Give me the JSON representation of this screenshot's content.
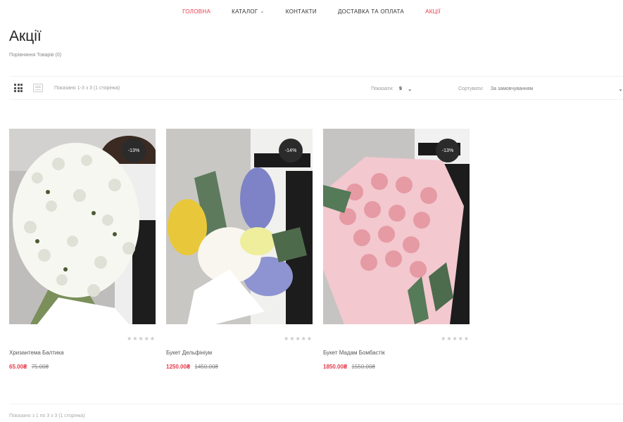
{
  "nav": {
    "items": [
      {
        "label": "ГОЛОВНА",
        "accent": true
      },
      {
        "label": "КАТАЛОГ",
        "accent": false,
        "dropdown": true
      },
      {
        "label": "КОНТАКТИ",
        "accent": false
      },
      {
        "label": "ДОСТАВКА ТА ОПЛАТА",
        "accent": false
      },
      {
        "label": "АКЦІЇ",
        "accent": true
      }
    ]
  },
  "page": {
    "title": "Акції",
    "compare": "Порівняння Товарів (0)"
  },
  "toolbar": {
    "showing": "Показано 1-3 з 3 (1 сторінка)",
    "per_page_label": "Показати:",
    "per_page_value": "9",
    "sort_label": "Сортувати:",
    "sort_value": "За замовчуванням"
  },
  "products": [
    {
      "name": "Хризантема Балтика",
      "price": "65.00₴",
      "old_price": "75.00₴",
      "discount": "-13%",
      "stars": "★★★★★"
    },
    {
      "name": "Букет Дельфініум",
      "price": "1250.00₴",
      "old_price": "1450.00₴",
      "discount": "-14%",
      "stars": "★★★★★"
    },
    {
      "name": "Букет Мадам Бомбастік",
      "price": "1850.00₴",
      "old_price": "1550.00₴",
      "discount": "-13%",
      "stars": "★★★★★"
    }
  ],
  "footer": {
    "showing": "Показано з 1 по 3 з 3 (1 сторінка)"
  },
  "colors": {
    "accent": "#e83a4a",
    "badge": "#2b2b2b"
  },
  "icons": [
    "grid-view-icon",
    "list-view-icon",
    "chevron-down-icon",
    "star-icon"
  ]
}
